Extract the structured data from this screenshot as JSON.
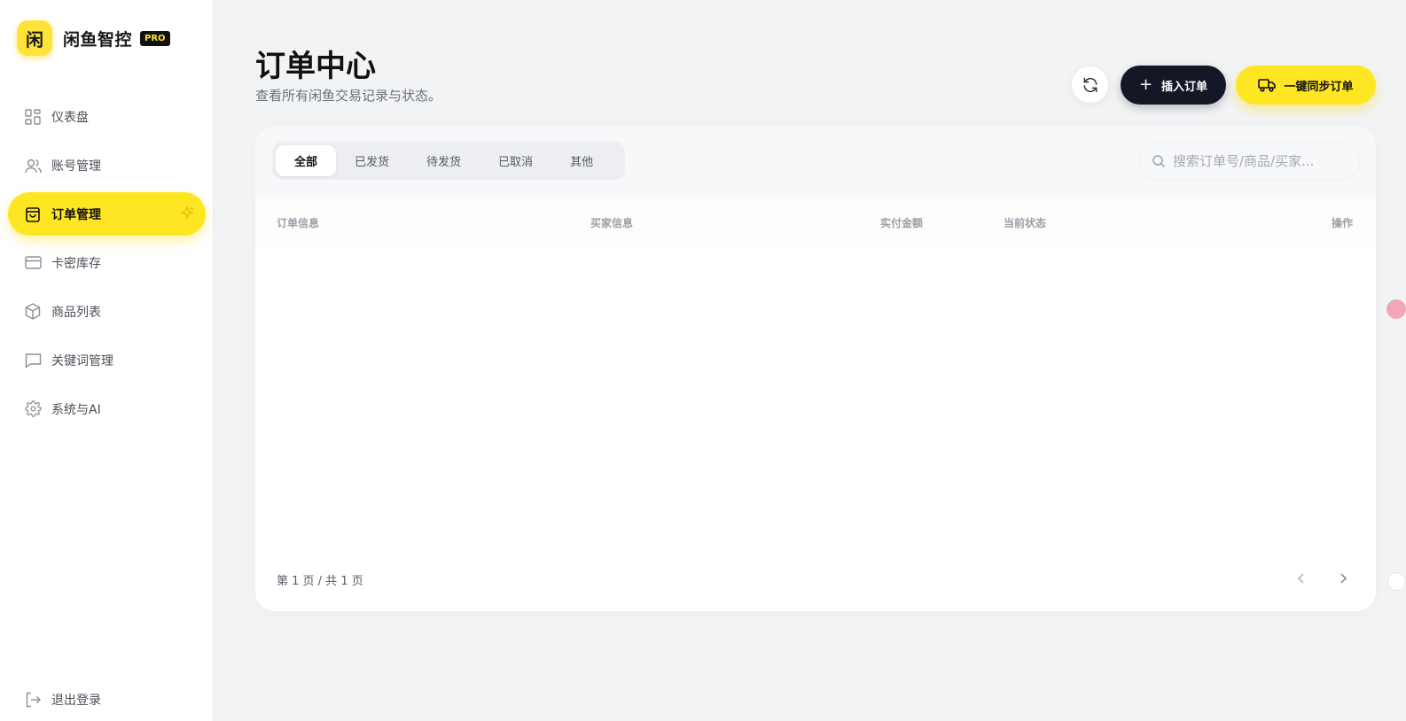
{
  "brand": {
    "logo_char": "闲",
    "name": "闲鱼智控",
    "badge": "PRO"
  },
  "sidebar": {
    "items": [
      {
        "label": "仪表盘",
        "icon": "grid-icon",
        "active": false
      },
      {
        "label": "账号管理",
        "icon": "users-icon",
        "active": false
      },
      {
        "label": "订单管理",
        "icon": "shopping-bag-icon",
        "active": true
      },
      {
        "label": "卡密库存",
        "icon": "credit-card-icon",
        "active": false
      },
      {
        "label": "商品列表",
        "icon": "box-icon",
        "active": false
      },
      {
        "label": "关键词管理",
        "icon": "message-icon",
        "active": false
      },
      {
        "label": "系统与AI",
        "icon": "gear-icon",
        "active": false
      }
    ],
    "logout_label": "退出登录"
  },
  "header": {
    "title": "订单中心",
    "subtitle": "查看所有闲鱼交易记录与状态。",
    "insert_label": "插入订单",
    "sync_label": "一键同步订单"
  },
  "tabs": [
    "全部",
    "已发货",
    "待发货",
    "已取消",
    "其他"
  ],
  "search": {
    "placeholder": "搜索订单号/商品/买家..."
  },
  "table": {
    "columns": [
      "订单信息",
      "买家信息",
      "实付金额",
      "当前状态",
      "操作"
    ],
    "rows": []
  },
  "pagination": {
    "text": "第 1 页 / 共 1 页"
  },
  "colors": {
    "accent": "#ffe622",
    "dark": "#141826",
    "background": "#f2f3f5"
  }
}
